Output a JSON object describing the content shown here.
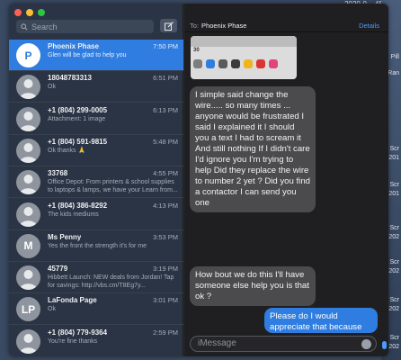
{
  "desktop": {
    "top_text": "2020-0... 45 PM",
    "right_labels": [
      "Pill",
      "Ran",
      "Scr",
      "201",
      "Scr",
      "201",
      "Scr",
      "202",
      "Scr",
      "202",
      "Scr",
      "202",
      "Scr",
      "202"
    ]
  },
  "sidebar": {
    "search_placeholder": "Search",
    "conversations": [
      {
        "name": "Phoenix Phase",
        "time": "7:50 PM",
        "preview": "Glen will be glad to help you",
        "selected": true,
        "avatar": "P"
      },
      {
        "name": "18048783313",
        "time": "6:51 PM",
        "preview": "Ok",
        "avatar": "person"
      },
      {
        "name": "+1 (804) 299-0005",
        "time": "6:13 PM",
        "preview": "Attachment: 1 image",
        "avatar": "person"
      },
      {
        "name": "+1 (804) 591-9815",
        "time": "5:48 PM",
        "preview": "Ok thanks 🙏",
        "avatar": "person"
      },
      {
        "name": "33768",
        "time": "4:55 PM",
        "preview": "Office Depot: From printers & school supplies to laptops & lamps, we have your Learn from...",
        "avatar": "person"
      },
      {
        "name": "+1 (804) 386-8292",
        "time": "4:13 PM",
        "preview": "The kids mediums",
        "avatar": "person"
      },
      {
        "name": "Ms Penny",
        "time": "3:53 PM",
        "preview": "Yes the front the strength it's for me",
        "avatar": "M"
      },
      {
        "name": "45779",
        "time": "3:19 PM",
        "preview": "Hibbett Launch: NEW deals from Jordan! Tap for savings: http://vbs.cm/T8Eg7y...",
        "avatar": "person"
      },
      {
        "name": "LaFonda Page",
        "time": "3:01 PM",
        "preview": "Ok",
        "avatar": "LP"
      },
      {
        "name": "+1 (804) 779-9364",
        "time": "2:59 PM",
        "preview": "You're fine thanks",
        "avatar": "person"
      }
    ]
  },
  "chat": {
    "to_label": "To:",
    "to_name": "Phoenix Phase",
    "details_label": "Details",
    "image_tag": "30",
    "messages": [
      {
        "from": "them",
        "text": "I simple said change the wire..... so many times ... anyone would be frustrated I said I explained it I should you a text I had to scream it And still nothing  If I didn't care I'd ignore you I'm trying to help Did they replace the wire to number 2 yet ?  Did you find a contactor I can send you one"
      },
      {
        "from": "them",
        "text": "How bout we do this I'll have someone else help you is that ok ?"
      },
      {
        "from": "me",
        "text": "Please do I would appreciate that because"
      }
    ],
    "input_placeholder": "iMessage"
  },
  "colors": {
    "selected": "#2f7de0",
    "sidebar_bg": "#2a3444",
    "chat_bg": "#1f1f21",
    "bubble_them": "#4b4b4d",
    "bubble_me": "#2f7de0"
  }
}
